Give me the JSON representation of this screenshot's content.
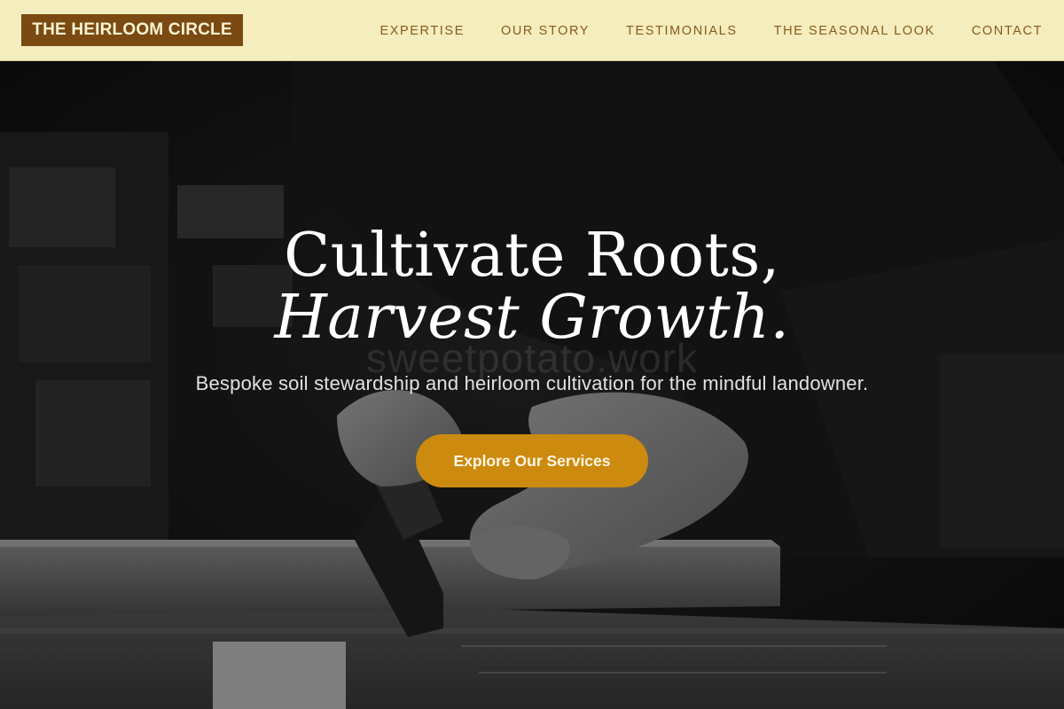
{
  "header": {
    "logo": "THE HEIRLOOM CIRCLE",
    "nav": [
      {
        "label": "EXPERTISE"
      },
      {
        "label": "OUR STORY"
      },
      {
        "label": "TESTIMONIALS"
      },
      {
        "label": "THE SEASONAL LOOK"
      },
      {
        "label": "CONTACT"
      }
    ]
  },
  "hero": {
    "headline_line1": "Cultivate Roots,",
    "headline_line2": "Harvest Growth.",
    "watermark": "sweetpotato.work",
    "subtitle": "Bespoke soil stewardship and heirloom cultivation for the mindful landowner.",
    "cta_label": "Explore Our Services",
    "background_image": "black-and-white photo of hands sawing a wooden plank on a workbench"
  },
  "colors": {
    "header_bg": "#f4edbd",
    "logo_bg": "#7a4a12",
    "nav_text": "#8a5a1c",
    "cta_bg": "#cc8a0e"
  }
}
